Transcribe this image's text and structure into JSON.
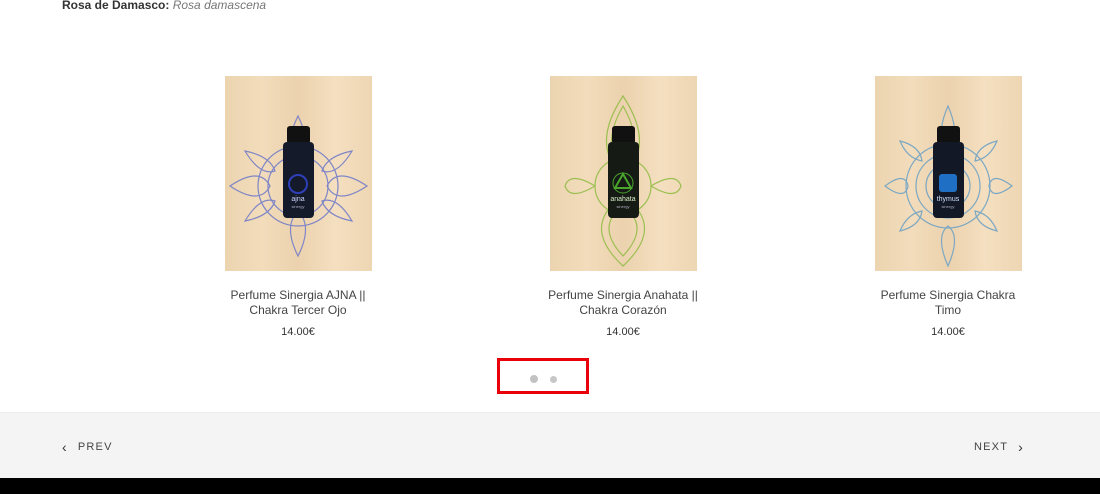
{
  "ingredient": {
    "name": "Rosa de Damasco:",
    "latin": "Rosa damascena"
  },
  "products": [
    {
      "title": "Perfume Sinergia AJNA || Chakra Tercer Ojo",
      "price": "14.00€",
      "label_top": "ajna",
      "label_bottom": "sinergy",
      "mandala_color": "#7f86c7",
      "emblem_color": "#2e3fb8"
    },
    {
      "title": "Perfume Sinergia Anahata || Chakra Corazón",
      "price": "14.00€",
      "label_top": "anahata",
      "label_bottom": "sinergy",
      "mandala_color": "#9cbf52",
      "emblem_color": "#49a52c"
    },
    {
      "title": "Perfume Sinergia Chakra Timo",
      "price": "14.00€",
      "label_top": "thymus",
      "label_bottom": "sinergy",
      "mandala_color": "#7ca8c4",
      "emblem_color": "#1f6fc4"
    }
  ],
  "carousel": {
    "dots": 2,
    "active": 1
  },
  "post_nav": {
    "prev": "PREV",
    "next": "NEXT"
  }
}
